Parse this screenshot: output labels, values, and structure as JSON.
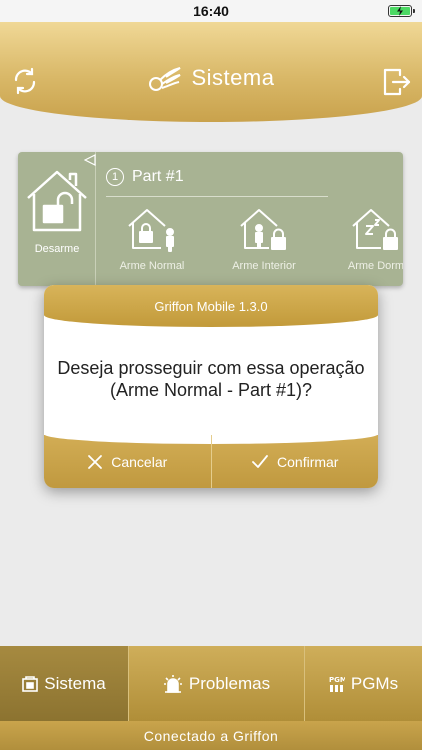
{
  "status_bar": {
    "time": "16:40"
  },
  "header": {
    "title": "Sistema",
    "refresh_icon": "refresh-icon",
    "logout_icon": "logout-icon",
    "logo_icon": "wing-logo-icon"
  },
  "partition": {
    "disarm_label": "Desarme",
    "number": "1",
    "name": "Part #1",
    "modes": [
      {
        "label": "Arme Normal",
        "icon": "house-person-icon"
      },
      {
        "label": "Arme Interior",
        "icon": "house-person-lock-icon"
      },
      {
        "label": "Arme Dorm",
        "icon": "house-sleep-icon"
      }
    ],
    "colors": {
      "card": "#a8b393"
    }
  },
  "dialog": {
    "title": "Griffon Mobile 1.3.0",
    "message_line1": "Deseja prosseguir com essa operação",
    "message_line2": "(Arme Normal - Part #1)?",
    "cancel_label": "Cancelar",
    "confirm_label": "Confirmar"
  },
  "tabs": [
    {
      "label": "Sistema",
      "icon": "system-icon",
      "active": true
    },
    {
      "label": "Problemas",
      "icon": "alarm-siren-icon",
      "active": false
    },
    {
      "label": "PGMs",
      "icon": "pgm-icon",
      "active": false
    }
  ],
  "footer": {
    "status": "Conectado a Griffon"
  },
  "colors": {
    "accent": "#c9a24c",
    "dialog_bg": "#ffffff"
  }
}
